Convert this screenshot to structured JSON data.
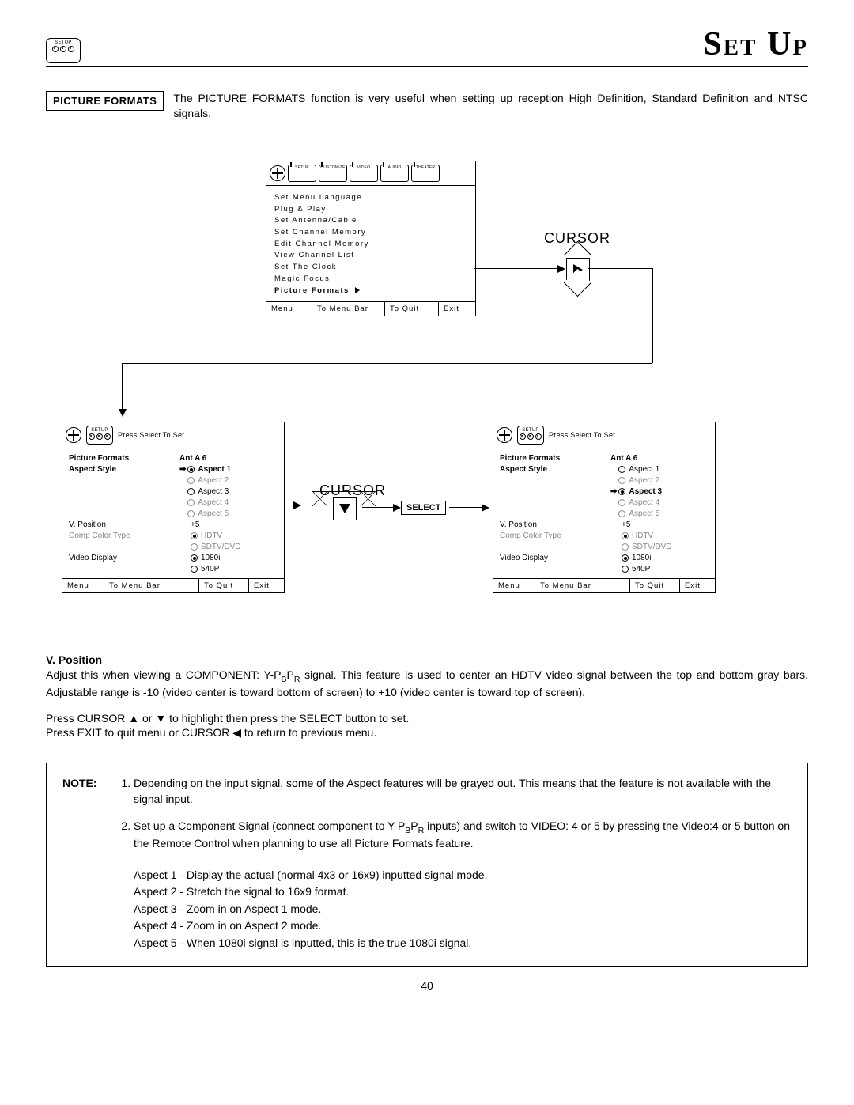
{
  "header": {
    "badge_label": "SETUP",
    "title": "Set Up"
  },
  "intro": {
    "label": "PICTURE FORMATS",
    "text": "The PICTURE FORMATS function is very useful when setting up reception High Definition, Standard Definition and NTSC signals."
  },
  "osd_main": {
    "tabs": [
      "SETUP",
      "CUSTOMIZE",
      "VIDEO",
      "AUDIO",
      "THEATER"
    ],
    "items": [
      "Set Menu Language",
      "Plug & Play",
      "Set Antenna/Cable",
      "Set Channel Memory",
      "Edit Channel Memory",
      "View Channel List",
      "Set The Clock",
      "Magic Focus"
    ],
    "highlight": "Picture Formats",
    "footer": {
      "menu": "Menu",
      "menubar": "To Menu Bar",
      "quit": "To Quit",
      "exit": "Exit"
    }
  },
  "cursor_right_label": "CURSOR",
  "cursor_down_label": "CURSOR",
  "select_label": "SELECT",
  "osd_left": {
    "press_select": "Press Select To Set",
    "title": "Picture Formats",
    "ant": "Ant A 6",
    "aspect_label": "Aspect Style",
    "aspects": [
      {
        "label": "Aspect 1",
        "sel": true,
        "ptr": true,
        "gray": false
      },
      {
        "label": "Aspect 2",
        "sel": false,
        "ptr": false,
        "gray": true
      },
      {
        "label": "Aspect 3",
        "sel": false,
        "ptr": false,
        "gray": false
      },
      {
        "label": "Aspect 4",
        "sel": false,
        "ptr": false,
        "gray": true
      },
      {
        "label": "Aspect 5",
        "sel": false,
        "ptr": false,
        "gray": true
      }
    ],
    "vpos_label": "V. Position",
    "vpos_val": "+5",
    "comp_label": "Comp Color Type",
    "comp_opts": [
      {
        "label": "HDTV",
        "sel": true,
        "gray": true
      },
      {
        "label": "SDTV/DVD",
        "sel": false,
        "gray": true
      }
    ],
    "vd_label": "Video Display",
    "vd_opts": [
      {
        "label": "1080i",
        "sel": true,
        "gray": false
      },
      {
        "label": "540P",
        "sel": false,
        "gray": false
      }
    ],
    "footer": {
      "menu": "Menu",
      "menubar": "To Menu Bar",
      "quit": "To Quit",
      "exit": "Exit"
    }
  },
  "osd_right": {
    "press_select": "Press Select To Set",
    "title": "Picture Formats",
    "ant": "Ant A 6",
    "aspect_label": "Aspect Style",
    "aspects": [
      {
        "label": "Aspect 1",
        "sel": false,
        "ptr": false,
        "gray": false
      },
      {
        "label": "Aspect 2",
        "sel": false,
        "ptr": false,
        "gray": true
      },
      {
        "label": "Aspect 3",
        "sel": true,
        "ptr": true,
        "gray": false
      },
      {
        "label": "Aspect 4",
        "sel": false,
        "ptr": false,
        "gray": true
      },
      {
        "label": "Aspect 5",
        "sel": false,
        "ptr": false,
        "gray": true
      }
    ],
    "vpos_label": "V. Position",
    "vpos_val": "+5",
    "comp_label": "Comp Color Type",
    "comp_opts": [
      {
        "label": "HDTV",
        "sel": true,
        "gray": true
      },
      {
        "label": "SDTV/DVD",
        "sel": false,
        "gray": true
      }
    ],
    "vd_label": "Video Display",
    "vd_opts": [
      {
        "label": "1080i",
        "sel": true,
        "gray": false
      },
      {
        "label": "540P",
        "sel": false,
        "gray": false
      }
    ],
    "footer": {
      "menu": "Menu",
      "menubar": "To Menu Bar",
      "quit": "To Quit",
      "exit": "Exit"
    }
  },
  "vpos_section": {
    "heading": "V. Position",
    "p1a": "Adjust this when viewing a COMPONENT: Y-P",
    "p1b": "B",
    "p1c": "P",
    "p1d": "R",
    "p1e": " signal.  This feature is used to center an HDTV video signal between the top and bottom gray bars.  Adjustable range is -10 (video center is toward bottom of screen) to +10 (video center is toward top of screen).",
    "p2": "Press CURSOR ▲ or ▼ to highlight then press the SELECT button to set.",
    "p3": "Press EXIT to quit menu or CURSOR ◀ to return to previous menu."
  },
  "note": {
    "label": "NOTE:",
    "n1": "Depending on the input signal, some of the Aspect features will be grayed out.  This means that the feature is not available with the signal input.",
    "n2a": "Set up a Component Signal (connect component to Y-P",
    "n2b": "B",
    "n2c": "P",
    "n2d": "R",
    "n2e": " inputs) and switch to VIDEO: 4 or 5 by pressing the Video:4 or 5 button on the Remote Control when planning to use all Picture Formats feature.",
    "aspects": [
      "Aspect 1 - Display the actual (normal 4x3 or 16x9) inputted signal mode.",
      "Aspect 2 - Stretch the signal to 16x9 format.",
      "Aspect 3 - Zoom in on Aspect 1 mode.",
      "Aspect 4 - Zoom in on Aspect 2 mode.",
      "Aspect 5 - When 1080i signal is inputted, this is the true 1080i signal."
    ]
  },
  "page_number": "40"
}
